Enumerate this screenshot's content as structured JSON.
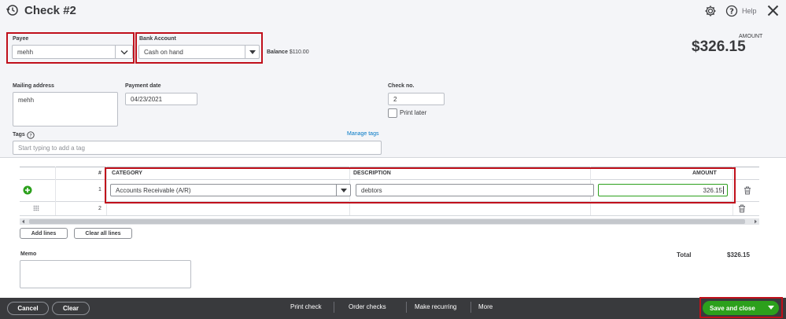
{
  "header": {
    "title": "Check #2",
    "help_label": "Help",
    "amount_label": "AMOUNT",
    "amount_value": "$326.15"
  },
  "form": {
    "payee_label": "Payee",
    "payee_value": "mehh",
    "bank_account_label": "Bank Account",
    "bank_account_value": "Cash on hand",
    "balance_label": "Balance",
    "balance_value": "$110.00",
    "mailing_address_label": "Mailing address",
    "mailing_address_value": "mehh",
    "payment_date_label": "Payment date",
    "payment_date_value": "04/23/2021",
    "check_no_label": "Check no.",
    "check_no_value": "2",
    "print_later_label": "Print later",
    "tags_label": "Tags",
    "manage_tags_label": "Manage tags",
    "tags_placeholder": "Start typing to add a tag"
  },
  "table": {
    "headers": {
      "num": "#",
      "category": "CATEGORY",
      "description": "DESCRIPTION",
      "amount": "AMOUNT"
    },
    "rows": [
      {
        "num": "1",
        "category": "Accounts Receivable (A/R)",
        "description": "debtors",
        "amount": "326.15"
      },
      {
        "num": "2",
        "category": "",
        "description": "",
        "amount": ""
      }
    ],
    "add_lines_label": "Add lines",
    "clear_all_lines_label": "Clear all lines"
  },
  "memo": {
    "label": "Memo",
    "total_label": "Total",
    "total_value": "$326.15"
  },
  "footer": {
    "cancel_label": "Cancel",
    "clear_label": "Clear",
    "print_check_label": "Print check",
    "order_checks_label": "Order checks",
    "make_recurring_label": "Make recurring",
    "more_label": "More",
    "save_and_close_label": "Save and close"
  },
  "colors": {
    "accent_green": "#2ca01c",
    "highlight_red": "#c0101b",
    "link_blue": "#0077c5",
    "footer_dark": "#393a3d"
  },
  "icons": [
    "history-icon",
    "gear-icon",
    "help-icon",
    "close-icon",
    "chevron-down-icon",
    "add-line-icon",
    "drag-handle-icon",
    "trash-icon",
    "caret-down-icon"
  ]
}
